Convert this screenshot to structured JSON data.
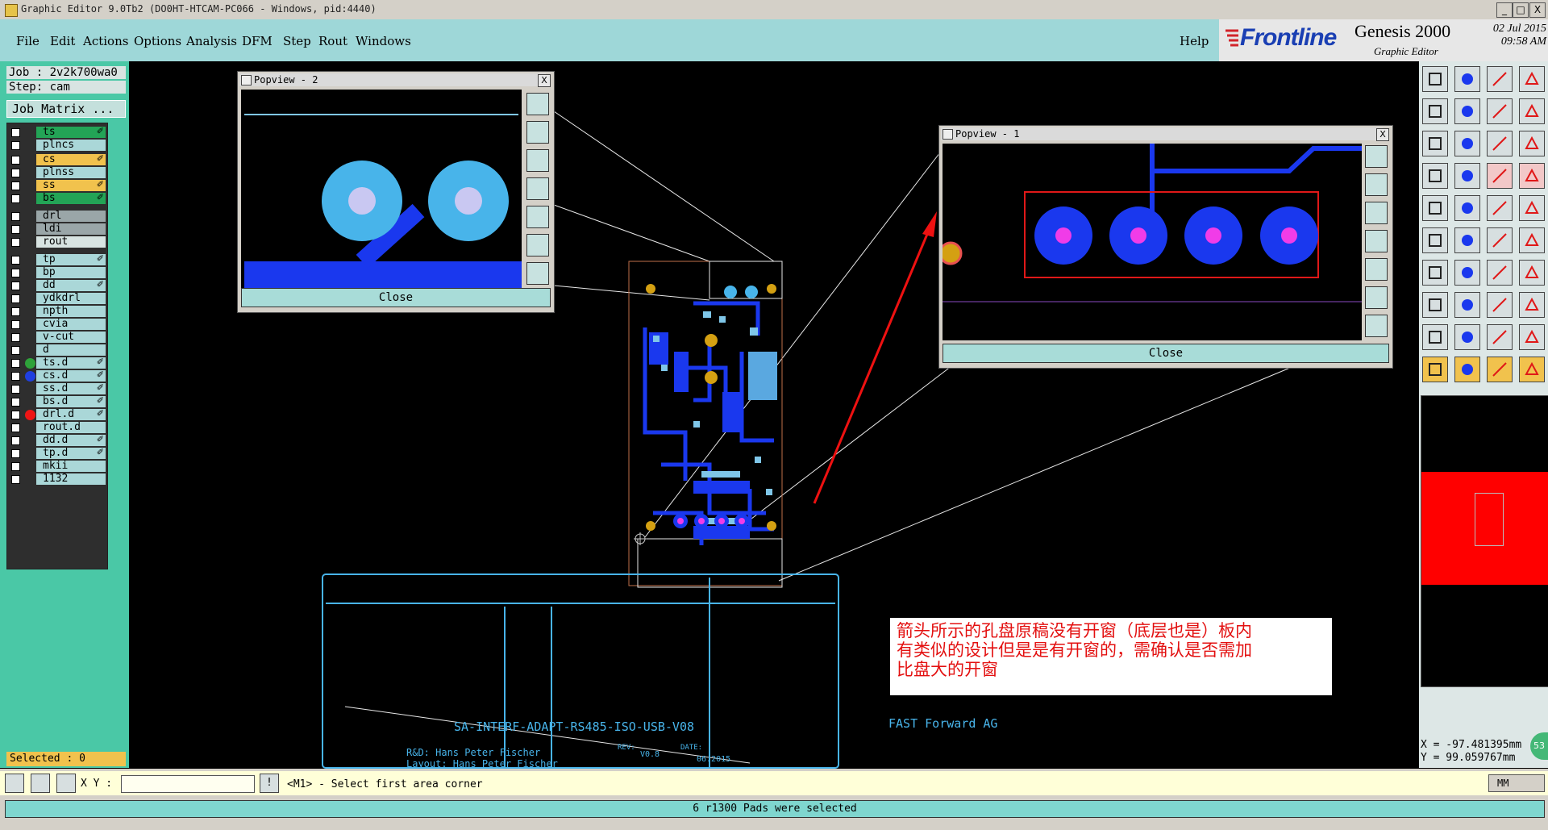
{
  "window": {
    "title": "Graphic Editor 9.0Tb2 (DO0HT-HTCAM-PC066 - Windows, pid:4440)",
    "min": "_",
    "max": "□",
    "close": "X"
  },
  "menu": [
    "File",
    "Edit",
    "Actions",
    "Options",
    "Analysis",
    "DFM",
    "Step",
    "Rout",
    "Windows"
  ],
  "help": "Help",
  "logo": {
    "brand": "Frontline",
    "product": "Genesis 2000",
    "subtitle": "Graphic Editor",
    "date": "02 Jul 2015",
    "time": "09:58 AM"
  },
  "job": {
    "job_line": "Job : 2v2k700wa0",
    "step_line": "Step: cam",
    "matrix": "Job Matrix ..."
  },
  "layers": [
    {
      "name": "ts",
      "color": "#23a456",
      "dot": "",
      "edit": true
    },
    {
      "name": "plncs",
      "color": "#aad7d8",
      "dot": "",
      "edit": false
    },
    {
      "name": "cs",
      "color": "#f1c24d",
      "dot": "",
      "edit": true
    },
    {
      "name": "plnss",
      "color": "#aad7d8",
      "dot": "",
      "edit": false
    },
    {
      "name": "ss",
      "color": "#f1c24d",
      "dot": "",
      "edit": true
    },
    {
      "name": "bs",
      "color": "#23a456",
      "dot": "",
      "edit": true
    },
    {
      "name": "drl",
      "color": "#9aa6a8",
      "dot": "",
      "edit": false
    },
    {
      "name": "ldi",
      "color": "#9aa6a8",
      "dot": "",
      "edit": false
    },
    {
      "name": "rout",
      "color": "#d8e4e2",
      "dot": "",
      "edit": false
    },
    {
      "name": "tp",
      "color": "#aad7d8",
      "dot": "",
      "edit": true
    },
    {
      "name": "bp",
      "color": "#aad7d8",
      "dot": "",
      "edit": false
    },
    {
      "name": "dd",
      "color": "#aad7d8",
      "dot": "",
      "edit": true
    },
    {
      "name": "ydkdrl",
      "color": "#aad7d8",
      "dot": "",
      "edit": false
    },
    {
      "name": "npth",
      "color": "#aad7d8",
      "dot": "",
      "edit": false
    },
    {
      "name": "cvia",
      "color": "#aad7d8",
      "dot": "",
      "edit": false
    },
    {
      "name": "v-cut",
      "color": "#aad7d8",
      "dot": "",
      "edit": false
    },
    {
      "name": "d",
      "color": "#aad7d8",
      "dot": "",
      "edit": false
    },
    {
      "name": "ts.d",
      "color": "#aad7d8",
      "dot": "#2ea23a",
      "edit": true
    },
    {
      "name": "cs.d",
      "color": "#aad7d8",
      "dot": "#1f3fe0",
      "edit": true
    },
    {
      "name": "ss.d",
      "color": "#aad7d8",
      "dot": "",
      "edit": true
    },
    {
      "name": "bs.d",
      "color": "#aad7d8",
      "dot": "",
      "edit": true
    },
    {
      "name": "drl.d",
      "color": "#aad7d8",
      "dot": "#ee1515",
      "edit": true
    },
    {
      "name": "rout.d",
      "color": "#aad7d8",
      "dot": "",
      "edit": false
    },
    {
      "name": "dd.d",
      "color": "#aad7d8",
      "dot": "",
      "edit": true
    },
    {
      "name": "tp.d",
      "color": "#aad7d8",
      "dot": "",
      "edit": true
    },
    {
      "name": "mkii",
      "color": "#aad7d8",
      "dot": "",
      "edit": false
    },
    {
      "name": "1132",
      "color": "#aad7d8",
      "dot": "",
      "edit": false
    }
  ],
  "selected": "Selected : 0",
  "popview1": {
    "title": "Popview - 1",
    "close": "Close",
    "close_x": "X"
  },
  "popview2": {
    "title": "Popview - 2",
    "close": "Close",
    "close_x": "X"
  },
  "annotation": {
    "line1": "箭头所示的孔盘原稿没有开窗（底层也是）板内",
    "line2": "有类似的设计但是是有开窗的，需确认是否需加",
    "line3": "比盘大的开窗"
  },
  "titleblock": {
    "name": "SA-INTERF-ADAPT-RS485-ISO-USB-V08",
    "company": "FAST Forward AG",
    "rd": "R&D: Hans Peter Fischer",
    "layout": "Layout: Hans Peter Fischer",
    "rev_label": "REV:",
    "rev": "V0.8",
    "date_label": "DATE:",
    "date": "06.2015"
  },
  "coords": {
    "x": "X = -97.481395mm",
    "y": "Y = 99.059767mm"
  },
  "xy_label": "X Y :",
  "prompt": "<M1> - Select first area corner",
  "status": "6 r1300 Pads were selected",
  "units": "MM",
  "badge": "53"
}
